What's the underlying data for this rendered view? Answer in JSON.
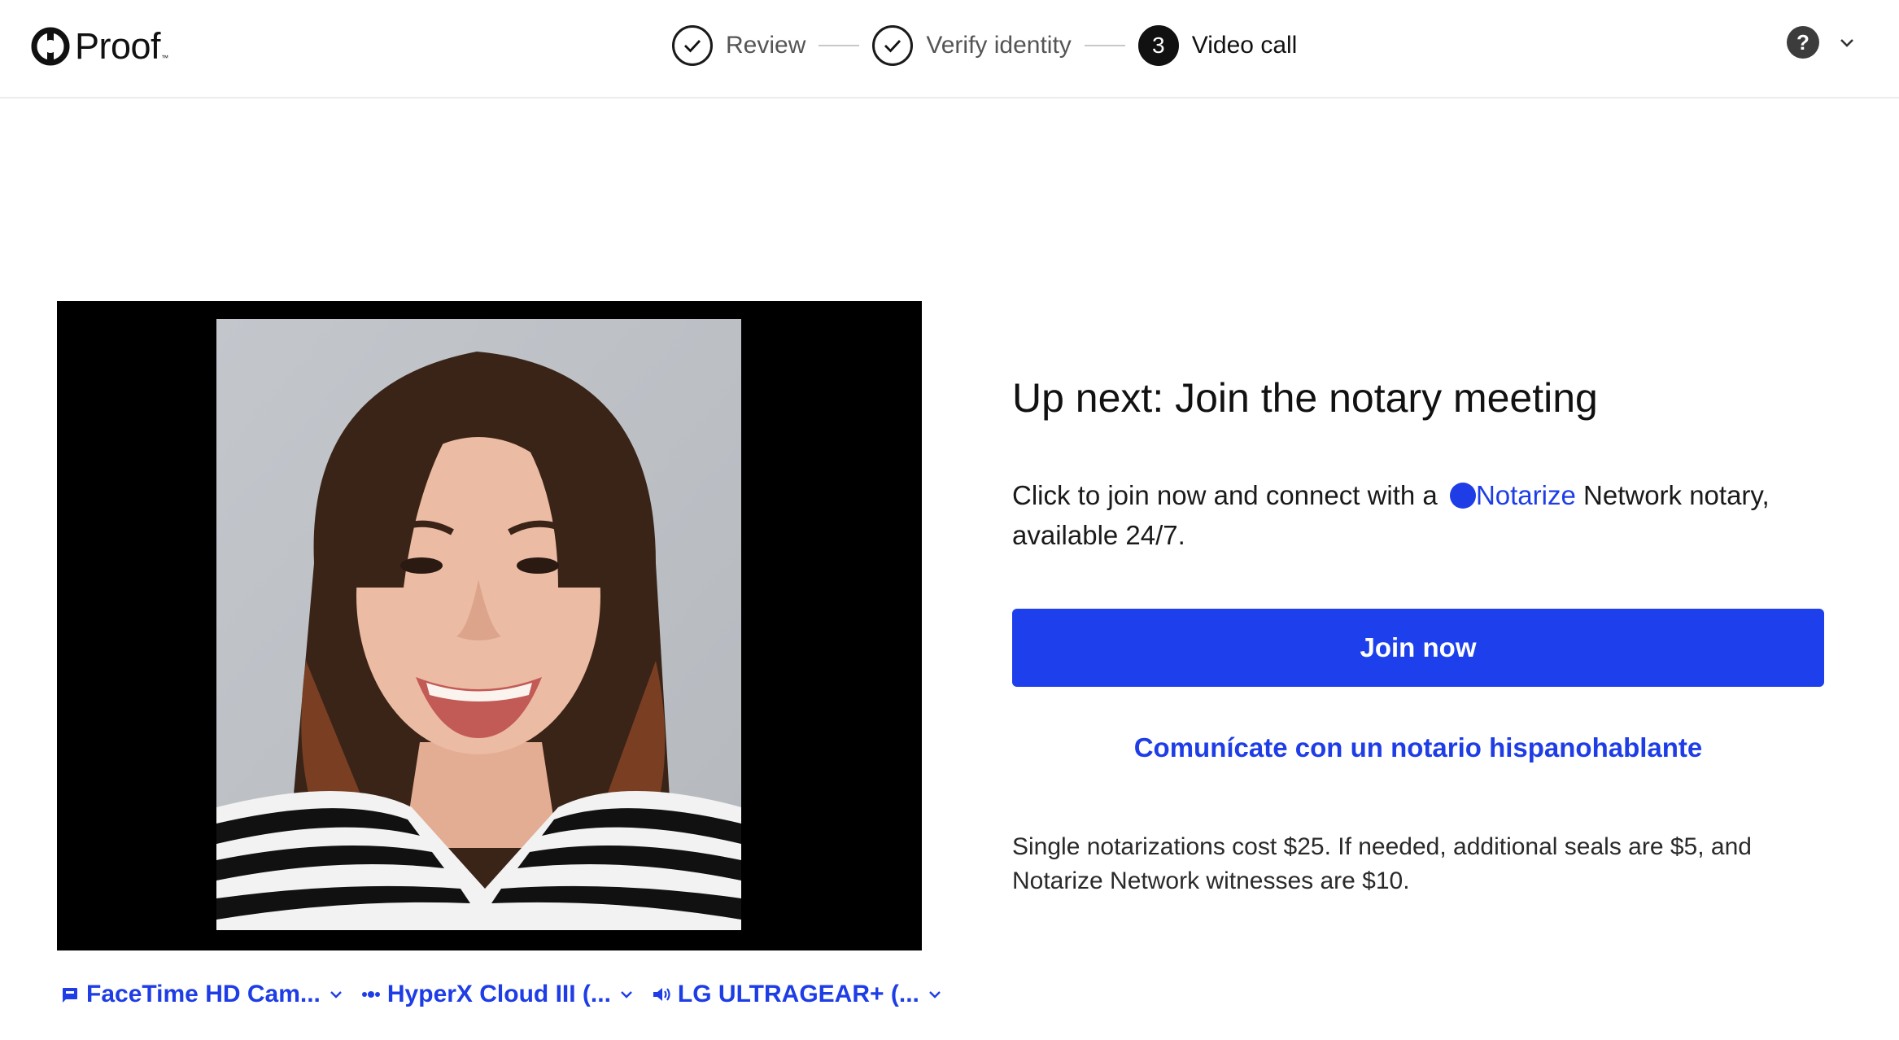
{
  "brand": {
    "name": "Proof",
    "tm": "™"
  },
  "steps": [
    {
      "label": "Review",
      "state": "done"
    },
    {
      "label": "Verify identity",
      "state": "done"
    },
    {
      "number": "3",
      "label": "Video call",
      "state": "active"
    }
  ],
  "help": {
    "icon": "?",
    "menu_icon": "chevron-down-icon"
  },
  "devices": {
    "camera": "FaceTime HD Cam...",
    "microphone": "HyperX Cloud III (...",
    "speaker": "LG ULTRAGEAR+ (..."
  },
  "panel": {
    "title": "Up next: Join the notary meeting",
    "desc_before": "Click to join now and connect with a ",
    "notarize_link": "Notarize",
    "desc_after": " Network notary, available 24/7.",
    "join_button": "Join now",
    "spanish_link": "Comunícate con un notario hispanohablante",
    "pricing": "Single notarizations cost $25. If needed, additional seals are $5, and Notarize Network witnesses are $10."
  },
  "colors": {
    "accent": "#1e40ec",
    "link": "#1e3de6",
    "video_bg": "#000000"
  }
}
